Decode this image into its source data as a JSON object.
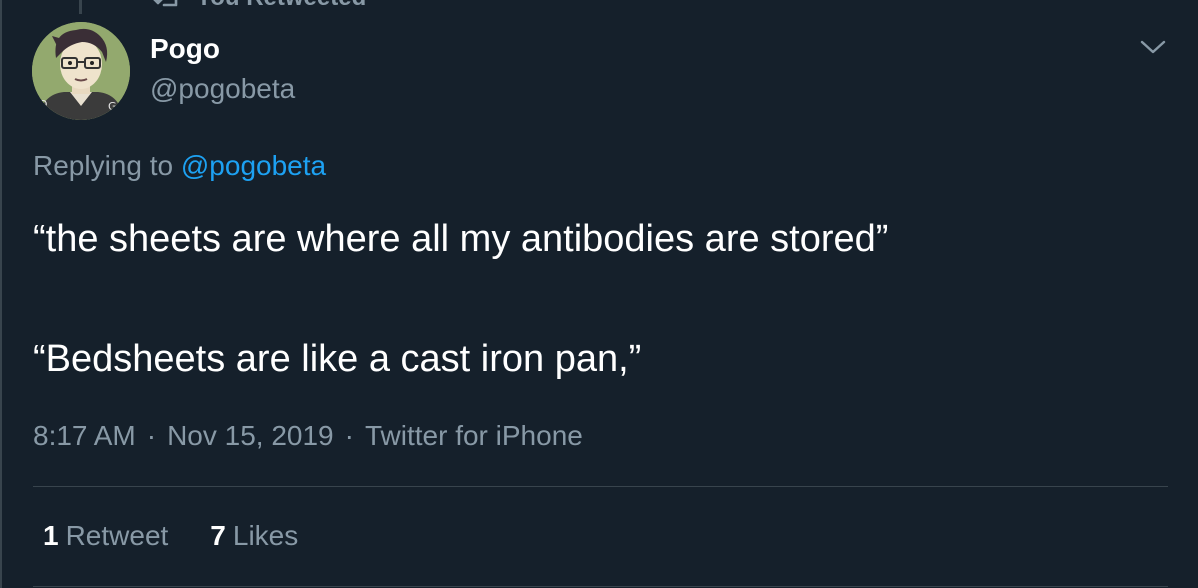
{
  "retweet_context": {
    "icon": "retweet-icon",
    "label": "You Retweeted"
  },
  "author": {
    "display_name": "Pogo",
    "handle": "@pogobeta",
    "avatar_icon": "cartoon-avatar"
  },
  "menu_icon": "chevron-down-icon",
  "replying": {
    "prefix": "Replying to ",
    "mention": "@pogobeta"
  },
  "tweet": {
    "paragraphs": [
      "“the sheets are where all my antibodies are stored”",
      "“Bedsheets are like a cast iron pan,”"
    ]
  },
  "meta": {
    "time": "8:17 AM",
    "date": "Nov 15, 2019",
    "source": "Twitter for iPhone",
    "separator": "·"
  },
  "stats": {
    "retweets_count": "1",
    "retweets_label": "Retweet",
    "likes_count": "7",
    "likes_label": "Likes"
  },
  "colors": {
    "background": "#15202b",
    "text": "#ffffff",
    "secondary": "#8899a6",
    "accent": "#1da1f2",
    "border": "#38444d"
  }
}
